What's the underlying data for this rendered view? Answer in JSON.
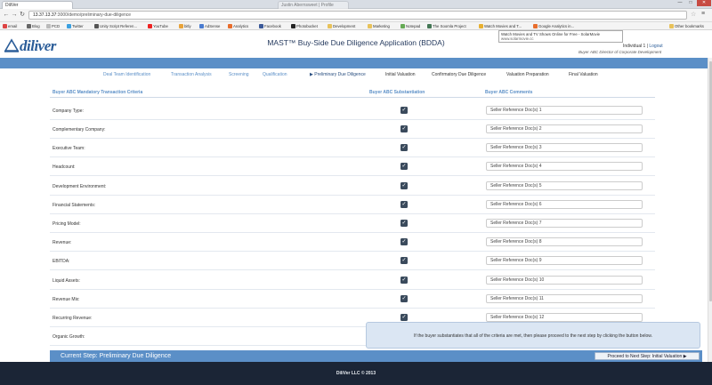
{
  "browser": {
    "tabs": [
      {
        "label": "DiliVer"
      },
      {
        "label": "Justin Abernsweet | Profile"
      }
    ],
    "url_host": "13.37.13.37",
    "url_path": ":3000/demo/preliminary-due-diligence",
    "bookmarks": [
      "email",
      "Blog",
      "PCD",
      "Twitter",
      "Unity Script Referen...",
      "YouTube",
      "bitly",
      "AdSense",
      "Analytics",
      "Facebook",
      "Photobucket",
      "Development",
      "Marketing",
      "Notepad",
      "The Soomla Project",
      "Watch Movies and T...",
      "Google Analytics in..."
    ],
    "other_bookmarks": "Other bookmarks",
    "tooltip_title": "Watch Movies and TV Shows Online for Free - SolarMovie",
    "tooltip_sub": "www.solarmovie.cc"
  },
  "app": {
    "logo": "diliver",
    "title": "MAST™ Buy-Side Due Diligence Application (BDDA)",
    "user": "Individual 1",
    "sep": " | ",
    "logout": "Logout",
    "role": "Buyer ABC Director of Corporate Development"
  },
  "steps": [
    "Deal Team Identification",
    "Transaction Analysis",
    "Screening",
    "Qualification",
    "▶ Preliminary Due Diligence",
    "Initial Valuation",
    "Confirmatory Due Diligence",
    "Valuation Preparation",
    "Final Valuation"
  ],
  "table": {
    "headers": [
      "Buyer ABC Mandatory Transaction Criteria",
      "Buyer ABC Substantiation",
      "Buyer ABC Comments"
    ],
    "rows": [
      {
        "label": "Company Type:",
        "checked": true,
        "comment": "Seller Reference Doc(s) 1"
      },
      {
        "label": "Complementary Company:",
        "checked": true,
        "comment": "Seller Reference Doc(s) 2"
      },
      {
        "label": "Executive Team:",
        "checked": true,
        "comment": "Seller Reference Doc(s) 3"
      },
      {
        "label": "Headcount:",
        "checked": true,
        "comment": "Seller Reference Doc(s) 4"
      },
      {
        "label": "Development Environment:",
        "checked": true,
        "comment": "Seller Reference Doc(s) 5"
      },
      {
        "label": "Financial Statements:",
        "checked": true,
        "comment": "Seller Reference Doc(s) 6"
      },
      {
        "label": "Pricing Model:",
        "checked": true,
        "comment": "Seller Reference Doc(s) 7"
      },
      {
        "label": "Revenue:",
        "checked": true,
        "comment": "Seller Reference Doc(s) 8"
      },
      {
        "label": "EBITDA:",
        "checked": true,
        "comment": "Seller Reference Doc(s) 9"
      },
      {
        "label": "Liquid Assets:",
        "checked": true,
        "comment": "Seller Reference Doc(s) 10"
      },
      {
        "label": "Revenue Mix:",
        "checked": true,
        "comment": "Seller Reference Doc(s) 11"
      },
      {
        "label": "Recurring Revenue:",
        "checked": true,
        "comment": "Seller Reference Doc(s) 12"
      },
      {
        "label": "Organic Growth:",
        "checked": true,
        "comment": ""
      }
    ]
  },
  "notice": "If the buyer substantiates that all of the criteria are met, then please proceed to the next step by clicking the button below.",
  "current_step": "Current Step: Preliminary Due Diligence",
  "next_button": "Proceed to Next Step: Initial Valuation ▶",
  "footer": "DiliVer LLC © 2013",
  "colors": {
    "accent": "#5b8fc7",
    "footer": "#1b2536",
    "header_text": "#253a5e"
  }
}
